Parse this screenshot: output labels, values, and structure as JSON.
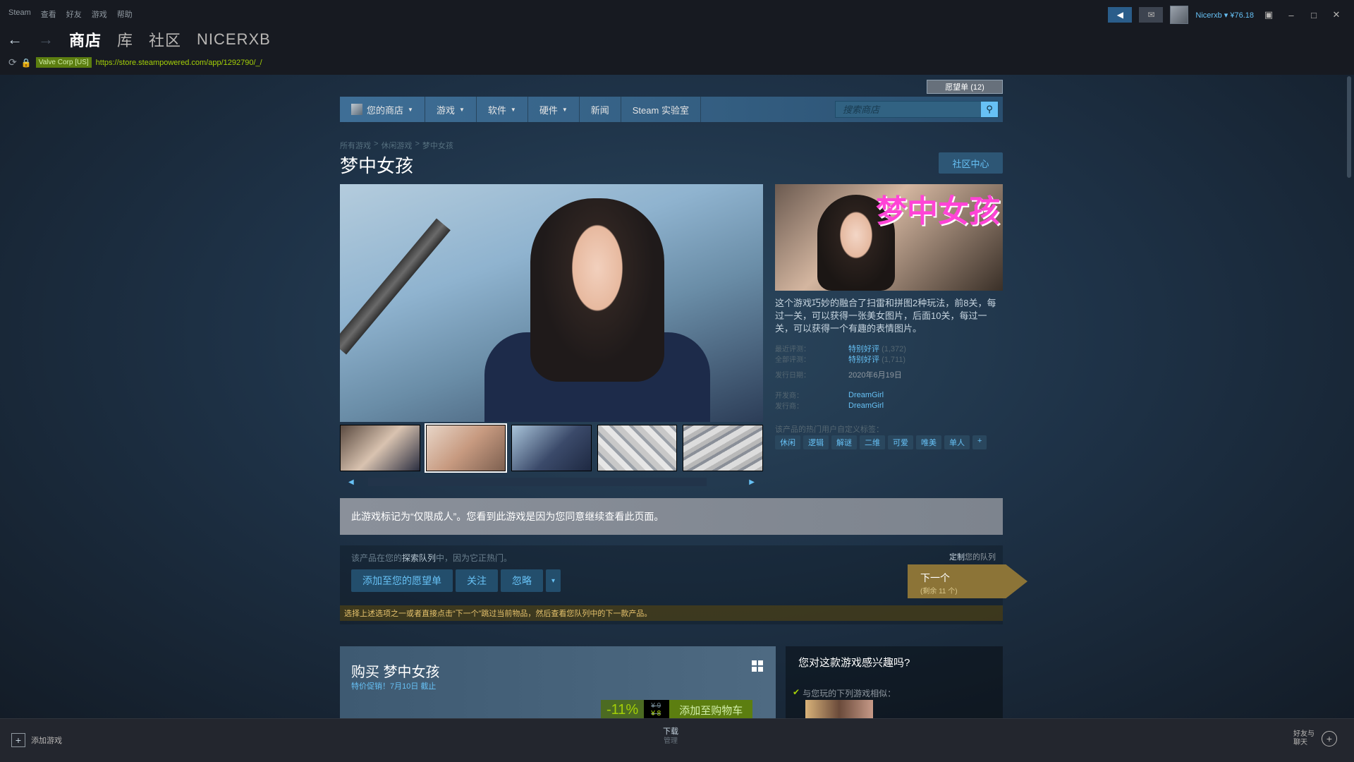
{
  "menubar": {
    "items": [
      "Steam",
      "查看",
      "好友",
      "游戏",
      "帮助"
    ]
  },
  "window": {
    "username": "Nicerxb ▾ ¥76.18"
  },
  "nav": {
    "tabs": [
      "商店",
      "库",
      "社区",
      "NICERXB"
    ]
  },
  "url": {
    "badge": "Valve Corp [US]",
    "text": "https://store.steampowered.com/app/1292790/_/"
  },
  "store": {
    "wishlist": "愿望单 (12)",
    "nav": [
      "您的商店",
      "游戏",
      "软件",
      "硬件",
      "新闻",
      "Steam 实验室"
    ],
    "search_placeholder": "搜索商店"
  },
  "breadcrumb": [
    "所有游戏",
    "休闲游戏",
    "梦中女孩"
  ],
  "breadcrumb_sep": ">",
  "game": {
    "title": "梦中女孩",
    "community_btn": "社区中心",
    "capsule_title": "梦中女孩",
    "description": "这个游戏巧妙的融合了扫雷和拼图2种玩法，前8关，每过一关，可以获得一张美女图片，后面10关，每过一关，可以获得一个有趣的表情图片。",
    "reviews": [
      {
        "label": "最近评测：",
        "value": "特别好评",
        "count": "(1,372)"
      },
      {
        "label": "全部评测：",
        "value": "特别好评",
        "count": "(1,711)"
      }
    ],
    "release": {
      "label": "发行日期：",
      "value": "2020年6月19日"
    },
    "developer": {
      "label": "开发商：",
      "value": "DreamGirl"
    },
    "publisher": {
      "label": "发行商：",
      "value": "DreamGirl"
    },
    "tags_label": "该产品的热门用户自定义标签：",
    "tags": [
      "休闲",
      "逻辑",
      "解谜",
      "二维",
      "可爱",
      "唯美",
      "单人",
      "+"
    ]
  },
  "mature": {
    "text": "此游戏标记为“仅限成人”。您看到此游戏是因为您同意继续查看此页面。"
  },
  "queue": {
    "text_pre": "该产品在您的",
    "text_bold": "探索队列",
    "text_post": "中，因为它正热门。",
    "customize_bold": "定制",
    "customize_rest": "您的队列",
    "buttons": [
      "添加至您的愿望单",
      "关注",
      "忽略",
      "▾"
    ],
    "next": "下一个",
    "next_sub": "(剩余 11 个)",
    "hint": "选择上述选项之一或者直接点击“下一个”跳过当前物品，然后查看您队列中的下一款产品。"
  },
  "purchase": {
    "title": "购买 梦中女孩",
    "sub": "特价促销！7月10日 截止",
    "discount": "-11%",
    "orig_price": "¥ 9",
    "final_price": "¥ 8",
    "cart": "添加至购物车"
  },
  "interest": {
    "title": "您对这款游戏感兴趣吗?",
    "similar": "与您玩的下列游戏相似："
  },
  "bottom": {
    "add_game": "添加游戏",
    "downloads": "下载",
    "manage": "管理",
    "friends_l1": "好友与",
    "friends_l2": "聊天"
  }
}
